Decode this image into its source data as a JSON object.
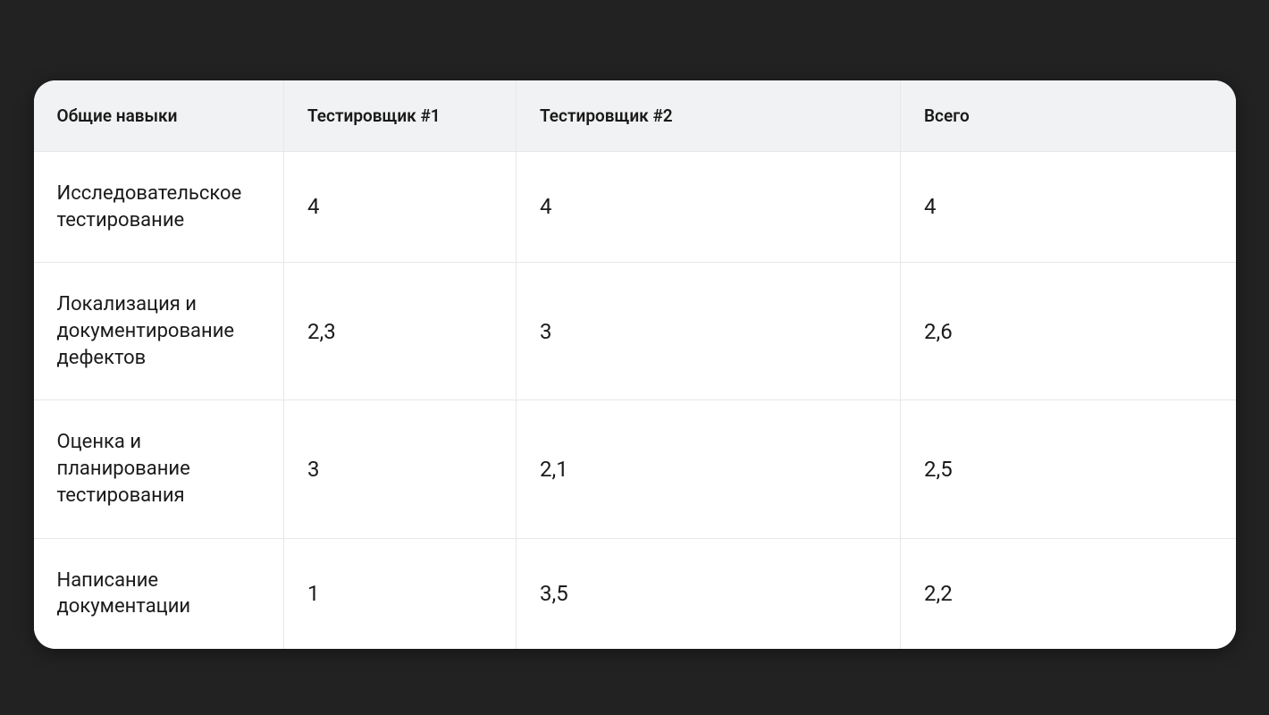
{
  "chart_data": {
    "type": "table",
    "title": "",
    "columns": [
      "Общие навыки",
      "Тестировщик #1",
      "Тестировщик #2",
      "Всего"
    ],
    "rows": [
      {
        "skill": "Исследовательское тестирование",
        "t1": "4",
        "t2": "4",
        "total": "4"
      },
      {
        "skill": "Локализация и документирование дефектов",
        "t1": "2,3",
        "t2": "3",
        "total": "2,6"
      },
      {
        "skill": "Оценка и планирование тестирования",
        "t1": "3",
        "t2": "2,1",
        "total": "2,5"
      },
      {
        "skill": "Написание документации",
        "t1": "1",
        "t2": "3,5",
        "total": "2,2"
      }
    ]
  }
}
